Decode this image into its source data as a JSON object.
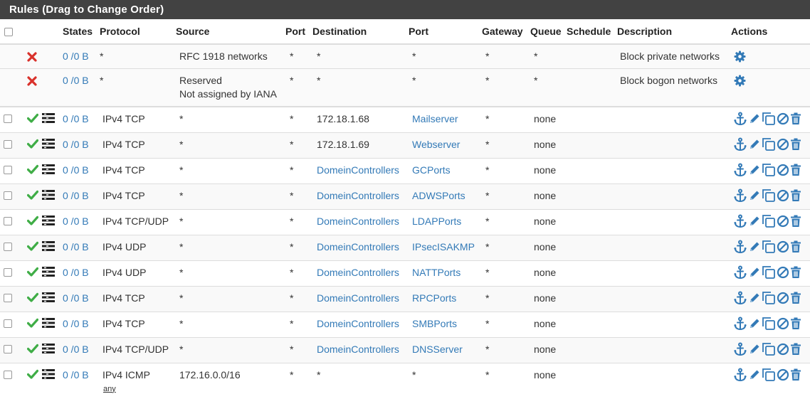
{
  "panel": {
    "title": "Rules (Drag to Change Order)"
  },
  "columns": {
    "states": "States",
    "protocol": "Protocol",
    "source": "Source",
    "port": "Port",
    "destination": "Destination",
    "dport": "Port",
    "gateway": "Gateway",
    "queue": "Queue",
    "schedule": "Schedule",
    "description": "Description",
    "actions": "Actions"
  },
  "system_rules": [
    {
      "states": "0 /0 B",
      "protocol": "*",
      "source": "RFC 1918 networks",
      "source2": "",
      "port": "*",
      "destination": "*",
      "dport": "*",
      "gateway": "*",
      "queue": "*",
      "description": "Block private networks"
    },
    {
      "states": "0 /0 B",
      "protocol": "*",
      "source": "Reserved",
      "source2": "Not assigned by IANA",
      "port": "*",
      "destination": "*",
      "dport": "*",
      "gateway": "*",
      "queue": "*",
      "description": "Block bogon networks"
    }
  ],
  "rules": [
    {
      "states": "0 /0 B",
      "protocol": "IPv4 TCP",
      "source": "*",
      "port": "*",
      "destination": "172.18.1.68",
      "dest_link": false,
      "dport": "Mailserver",
      "gateway": "*",
      "queue": "none"
    },
    {
      "states": "0 /0 B",
      "protocol": "IPv4 TCP",
      "source": "*",
      "port": "*",
      "destination": "172.18.1.69",
      "dest_link": false,
      "dport": "Webserver",
      "gateway": "*",
      "queue": "none"
    },
    {
      "states": "0 /0 B",
      "protocol": "IPv4 TCP",
      "source": "*",
      "port": "*",
      "destination": "DomeinControllers",
      "dest_link": true,
      "dport": "GCPorts",
      "gateway": "*",
      "queue": "none"
    },
    {
      "states": "0 /0 B",
      "protocol": "IPv4 TCP",
      "source": "*",
      "port": "*",
      "destination": "DomeinControllers",
      "dest_link": true,
      "dport": "ADWSPorts",
      "gateway": "*",
      "queue": "none"
    },
    {
      "states": "0 /0 B",
      "protocol": "IPv4 TCP/UDP",
      "source": "*",
      "port": "*",
      "destination": "DomeinControllers",
      "dest_link": true,
      "dport": "LDAPPorts",
      "gateway": "*",
      "queue": "none"
    },
    {
      "states": "0 /0 B",
      "protocol": "IPv4 UDP",
      "source": "*",
      "port": "*",
      "destination": "DomeinControllers",
      "dest_link": true,
      "dport": "IPsecISAKMP",
      "gateway": "*",
      "queue": "none"
    },
    {
      "states": "0 /0 B",
      "protocol": "IPv4 UDP",
      "source": "*",
      "port": "*",
      "destination": "DomeinControllers",
      "dest_link": true,
      "dport": "NATTPorts",
      "gateway": "*",
      "queue": "none"
    },
    {
      "states": "0 /0 B",
      "protocol": "IPv4 TCP",
      "source": "*",
      "port": "*",
      "destination": "DomeinControllers",
      "dest_link": true,
      "dport": "RPCPorts",
      "gateway": "*",
      "queue": "none"
    },
    {
      "states": "0 /0 B",
      "protocol": "IPv4 TCP",
      "source": "*",
      "port": "*",
      "destination": "DomeinControllers",
      "dest_link": true,
      "dport": "SMBPorts",
      "gateway": "*",
      "queue": "none"
    },
    {
      "states": "0 /0 B",
      "protocol": "IPv4 TCP/UDP",
      "source": "*",
      "port": "*",
      "destination": "DomeinControllers",
      "dest_link": true,
      "dport": "DNSServer",
      "gateway": "*",
      "queue": "none"
    },
    {
      "states": "0 /0 B",
      "protocol": "IPv4 ICMP",
      "protocol_sub": "any",
      "source": "172.16.0.0/16",
      "port": "*",
      "destination": "*",
      "dest_link": false,
      "dport": "*",
      "dport_plain": true,
      "gateway": "*",
      "queue": "none"
    }
  ],
  "colors": {
    "header_bg": "#424242",
    "link": "#337ab7",
    "pass": "#3fad46",
    "block": "#d9312b"
  }
}
